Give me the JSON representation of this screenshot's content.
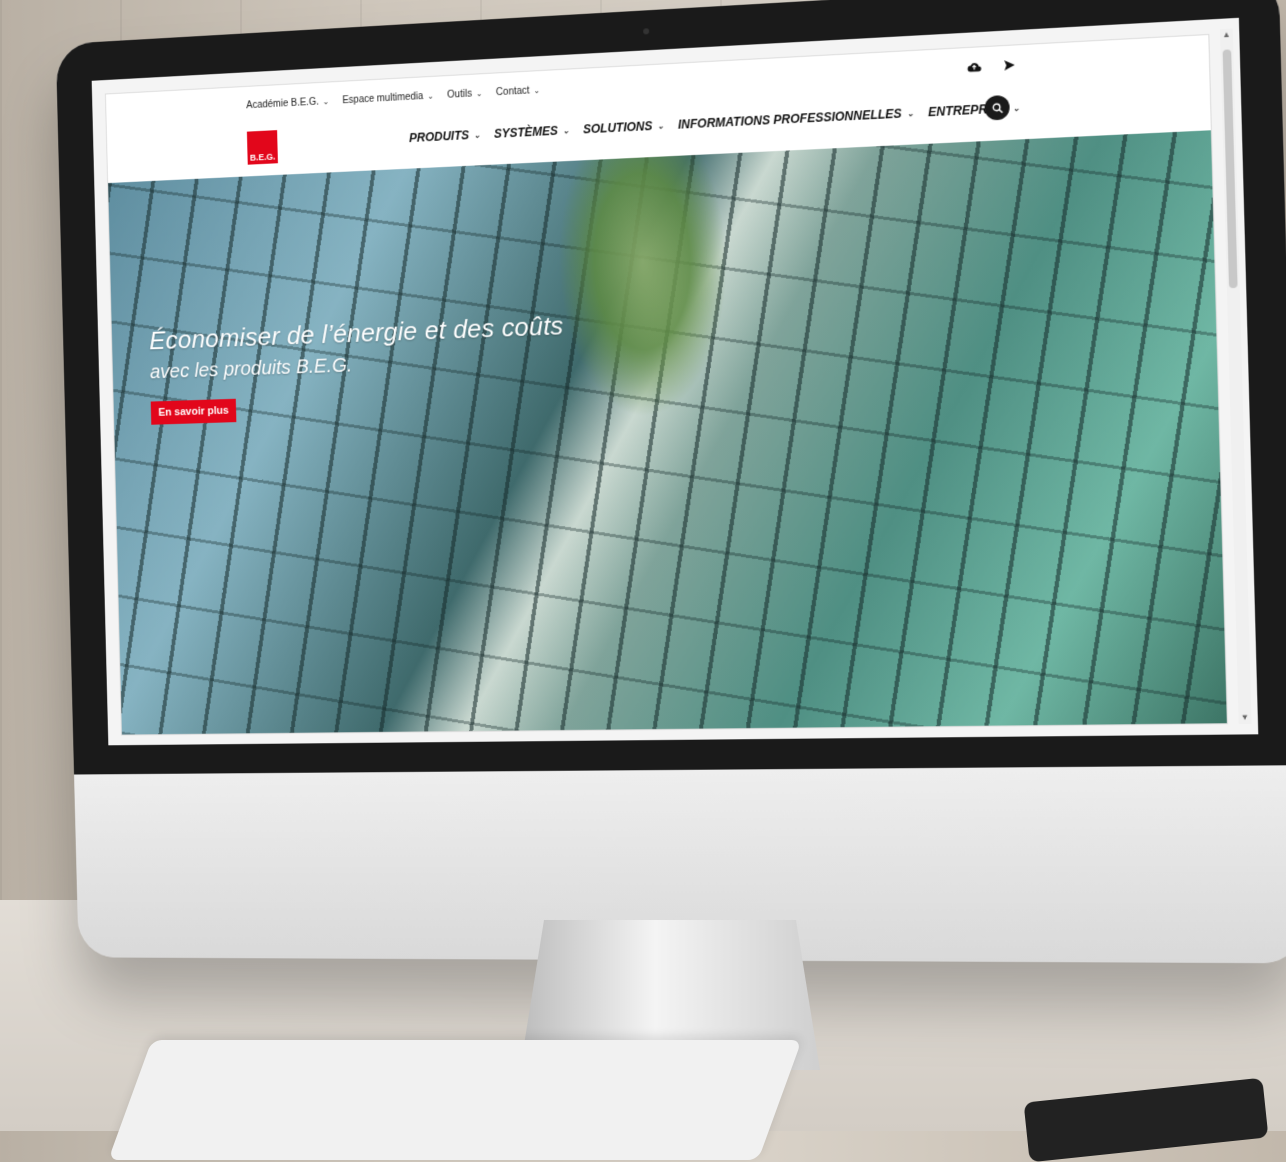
{
  "top_nav": {
    "items": [
      {
        "label": "Académie B.E.G."
      },
      {
        "label": "Espace multimedia"
      },
      {
        "label": "Outils"
      },
      {
        "label": "Contact"
      }
    ],
    "chevron": "⌄"
  },
  "top_icons": [
    "cloud-upload-icon",
    "send-icon"
  ],
  "brand": {
    "logo_text": "B.E.G.",
    "color": "#e2061b"
  },
  "main_nav": {
    "items": [
      {
        "label": "PRODUITS"
      },
      {
        "label": "SYSTÈMES"
      },
      {
        "label": "SOLUTIONS"
      },
      {
        "label": "INFORMATIONS PROFESSIONNELLES"
      },
      {
        "label": "ENTREPRISE"
      }
    ]
  },
  "hero": {
    "headline": "Économiser de l’énergie et des coûts",
    "subline": "avec les produits B.E.G.",
    "cta_label": "En savoir plus"
  }
}
